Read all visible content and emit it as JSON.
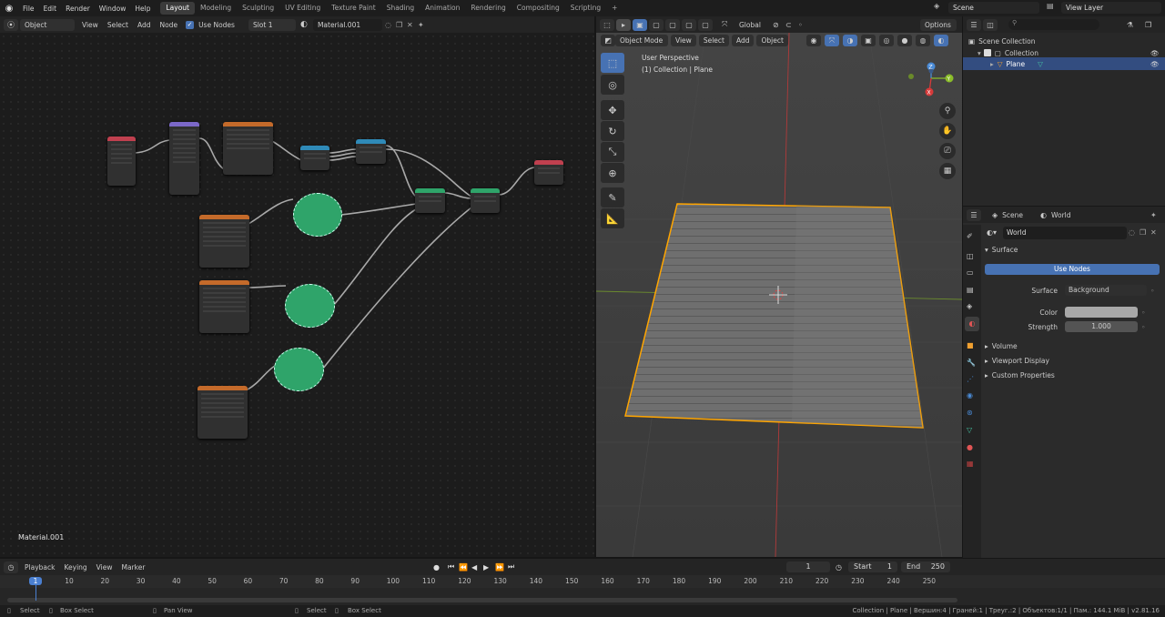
{
  "topbar": {
    "menu": [
      "File",
      "Edit",
      "Render",
      "Window",
      "Help"
    ],
    "tabs": [
      "Layout",
      "Modeling",
      "Sculpting",
      "UV Editing",
      "Texture Paint",
      "Shading",
      "Animation",
      "Rendering",
      "Compositing",
      "Scripting"
    ],
    "active_tab": "Layout",
    "add_tab": "+",
    "scene": "Scene",
    "view_layer": "View Layer"
  },
  "node_header": {
    "editor_mode": "Object",
    "menu": [
      "View",
      "Select",
      "Add",
      "Node"
    ],
    "use_nodes": "Use Nodes",
    "slot": "Slot 1",
    "material": "Material.001"
  },
  "node_editor": {
    "material_label": "Material.001"
  },
  "viewport_header": {
    "orientation": "Global",
    "options": "Options",
    "mode": "Object Mode",
    "menu": [
      "View",
      "Select",
      "Add",
      "Object"
    ]
  },
  "viewport": {
    "perspective": "User Perspective",
    "collection_info": "(1) Collection | Plane",
    "gizmo_axes": [
      "X",
      "Y",
      "Z"
    ]
  },
  "outliner": {
    "scene_collection": "Scene Collection",
    "collection": "Collection",
    "plane": "Plane"
  },
  "properties": {
    "scene": "Scene",
    "world_tab": "World",
    "world_name": "World",
    "panel_surface": "Surface",
    "use_nodes_button": "Use Nodes",
    "surface_label": "Surface",
    "surface_value": "Background",
    "color_label": "Color",
    "strength_label": "Strength",
    "strength_value": "1.000",
    "panels": [
      "Volume",
      "Viewport Display",
      "Custom Properties"
    ]
  },
  "timeline": {
    "menu": [
      "Playback",
      "Keying",
      "View",
      "Marker"
    ],
    "current_frame": "1",
    "start_label": "Start",
    "start_value": "1",
    "end_label": "End",
    "end_value": "250",
    "ruler": [
      "1",
      "10",
      "20",
      "30",
      "40",
      "50",
      "60",
      "70",
      "80",
      "90",
      "100",
      "110",
      "120",
      "130",
      "140",
      "150",
      "160",
      "170",
      "180",
      "190",
      "200",
      "210",
      "220",
      "230",
      "240",
      "250"
    ]
  },
  "status": {
    "left": [
      "Select",
      "Box Select",
      "Pan View",
      "Select",
      "Box Select"
    ],
    "right": "Collection | Plane | Вершин:4 | Граней:1 | Треуг.:2 | Объектов:1/1 | Пам.: 144.1 MiB | v2.81.16"
  },
  "colors": {
    "accent": "#4772b3",
    "active_tab": "#3b3b3b",
    "selection_orange": "#ffa500",
    "frame_marker": "#4a7fd0",
    "frame_green": "#2fa46a",
    "color_swatch": "#a8a8a8"
  }
}
